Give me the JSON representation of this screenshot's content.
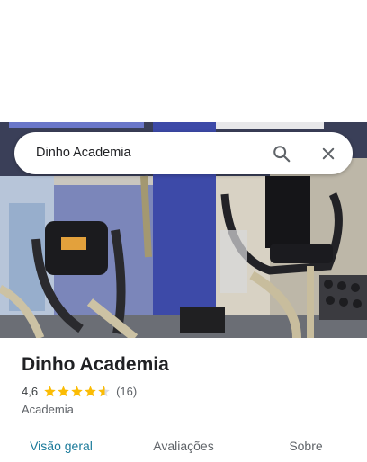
{
  "search": {
    "query": "Dinho Academia"
  },
  "place": {
    "name": "Dinho Academia",
    "rating": "4,6",
    "rating_value": 4.6,
    "review_count": "(16)",
    "category": "Academia"
  },
  "tabs": [
    {
      "label": "Visão geral",
      "active": true
    },
    {
      "label": "Avaliações",
      "active": false
    },
    {
      "label": "Sobre",
      "active": false
    }
  ],
  "colors": {
    "accent": "#1a7a9a",
    "star": "#fbbc04",
    "text": "#202124",
    "muted": "#5f6368"
  },
  "icons": {
    "search": "search-icon",
    "close": "close-icon",
    "star": "star-icon"
  }
}
